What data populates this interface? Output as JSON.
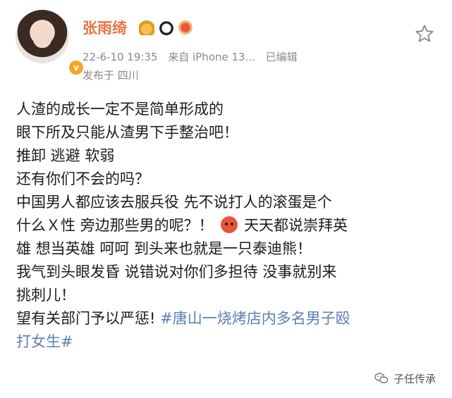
{
  "author": {
    "name": "张雨绮",
    "verified_badge": "v",
    "badge_icons": [
      "crown-icon",
      "panda-icon",
      "dragon-icon"
    ]
  },
  "meta": {
    "time": "22-6-10 19:35",
    "source": "来自 iPhone 13...",
    "edited": "已编辑",
    "location": "发布于 四川"
  },
  "post": {
    "lines": [
      "人渣的成长一定不是简单形成的",
      "眼下所及只能从渣男下手整治吧！",
      "推卸 逃避 软弱",
      "还有你们不会的吗？",
      "中国男人都应该去服兵役 先不说打人的滚蛋是个",
      "什么Ｘ性 旁边那些男的呢？！",
      "天天都说崇拜英",
      "雄 想当英雄 呵呵 到头来也就是一只泰迪熊！",
      "我气到头眼发昏 说错说对你们多担待 没事就别来",
      "挑刺儿！",
      "望有关部门予以严惩!",
      "#唐山一烧烤店内多名男子殴",
      "打女生#"
    ],
    "emoji": "angry-face-icon"
  },
  "watermark": {
    "text": "子任传承"
  },
  "colors": {
    "name": "#eb7340",
    "hashtag": "#5b7fb5",
    "meta": "#8a8a8a"
  }
}
